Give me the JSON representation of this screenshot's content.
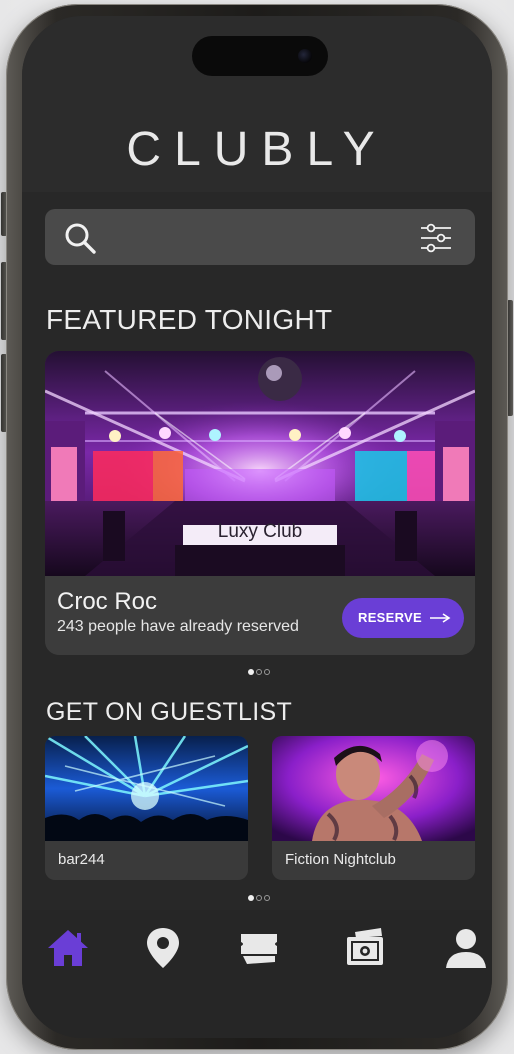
{
  "app": {
    "brand": "CLUBLY"
  },
  "search": {
    "value": "",
    "placeholder": "",
    "search_icon": "search-icon",
    "filter_icon": "sliders-filter-icon"
  },
  "featured": {
    "section_title": "FEATURED TONIGHT",
    "image_label": "Luxy Club",
    "venue_name": "Croc Roc",
    "subtitle": "243 people have already reserved",
    "reserve_label": "RESERVE",
    "reserve_icon": "arrow-right-icon",
    "pager": {
      "active_index": 0,
      "count": 3
    }
  },
  "guestlist": {
    "section_title": "GET ON GUESTLIST",
    "cards": [
      {
        "name": "bar244"
      },
      {
        "name": "Fiction Nightclub"
      }
    ],
    "pager": {
      "active_index": 0,
      "count": 3
    }
  },
  "nav": {
    "items": [
      {
        "icon": "home-icon",
        "active": true
      },
      {
        "icon": "map-pin-icon",
        "active": false
      },
      {
        "icon": "ticket-icon",
        "active": false
      },
      {
        "icon": "wallet-cash-icon",
        "active": false
      },
      {
        "icon": "user-profile-icon",
        "active": false
      }
    ]
  },
  "colors": {
    "accent": "#6a3ed6",
    "screen_bg": "#282828",
    "card_bg": "#3c3c3c",
    "search_bg": "#4a4a4a",
    "nav_active": "#6a3ed6",
    "nav_inactive": "#e6e6e6"
  }
}
